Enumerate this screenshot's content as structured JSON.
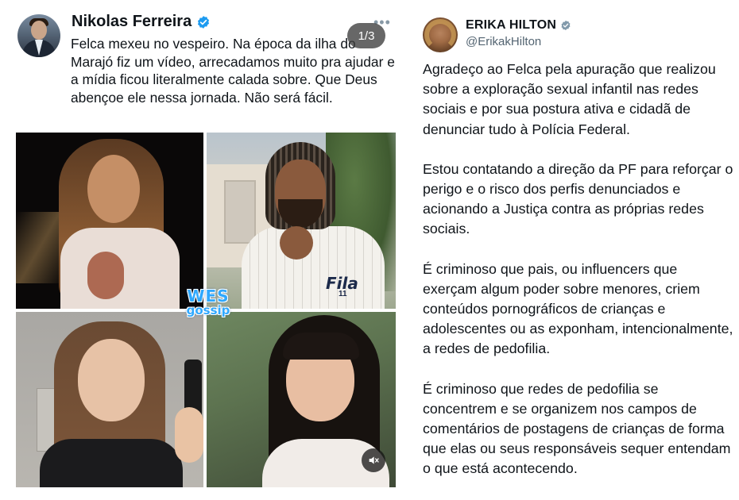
{
  "left_post": {
    "author_name": "Nikolas Ferreira",
    "more_icon": "more-horizontal-icon",
    "pager": "1/3",
    "text": "Felca mexeu no vespeiro. Na época da ilha do Marajó fiz um vídeo, arrecadamos muito pra ajudar e a mídia ficou literalmente calada sobre. Que Deus abençoe ele nessa jornada. Não será fácil.",
    "watermark_top": "WES",
    "watermark_bottom": "gossip",
    "jersey_logo": "Fila",
    "jersey_logo_sub": "11",
    "media_icon": "speaker-muted-icon",
    "verified_color": "#1d9bf0"
  },
  "right_post": {
    "author_name": "ERIKA HILTON",
    "handle": "@ErikakHilton",
    "paragraphs": [
      "Agradeço ao Felca pela apuração que realizou sobre a exploração sexual infantil nas redes sociais e por sua postura ativa e cidadã de denunciar tudo à Polícia Federal.",
      "Estou contatando a direção da PF para reforçar o perigo e o risco dos perfis denunciados e acionando a Justiça contra as próprias redes sociais.",
      "É criminoso que pais, ou influencers que exerçam algum poder sobre menores, criem conteúdos pornográficos de crianças e adolescentes ou as exponham, intencionalmente, a redes de pedofilia.",
      "É criminoso que redes de pedofilia se concentrem e se organizem nos campos de comentários de postagens de crianças de forma que elas ou seus responsáveis sequer entendam o que está acontecendo."
    ],
    "verified_color": "#829aab"
  }
}
